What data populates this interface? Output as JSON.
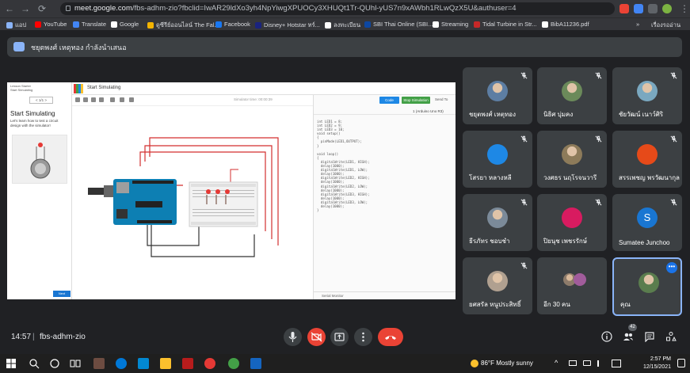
{
  "browser": {
    "url_host": "meet.google.com",
    "url_path": "/fbs-adhm-zio?fbclid=IwAR29ldXo3yh4NpYiwgXPUOCy3XHUQt1Tr-QUhl-yUS7n9xAWbh1RLwQzX5U&authuser=4",
    "bookmarks": [
      {
        "label": "แอป",
        "color": "#8ab4f8"
      },
      {
        "label": "YouTube",
        "color": "#ff0000"
      },
      {
        "label": "Translate",
        "color": "#4285f4"
      },
      {
        "label": "Google",
        "color": "#ffffff"
      },
      {
        "label": "ดูซีรีย์ออนไลน์ The Fal...",
        "color": "#f4b400"
      },
      {
        "label": "Facebook",
        "color": "#1877f2"
      },
      {
        "label": "Disney+ Hotstar ทร์...",
        "color": "#1a237e"
      },
      {
        "label": "ลงทะเบียน",
        "color": "#ffffff"
      },
      {
        "label": "SBI Thai Online (SBI...",
        "color": "#0d47a1"
      },
      {
        "label": "Streaming",
        "color": "#ffffff"
      },
      {
        "label": "Tidal Turbine in Str...",
        "color": "#c62828"
      },
      {
        "label": "BibA11236.pdf",
        "color": "#ffffff"
      }
    ],
    "reading_list": "เรื่องรออ่าน",
    "more": "»"
  },
  "presenter": {
    "text": "ชยุตพงศ์ เหตุทอง กำลังนำเสนอ"
  },
  "tinkercad": {
    "left_header": "Lesson Starter",
    "left_header2": "Start Simulating",
    "step_label": "< 1/1 >",
    "lesson_title": "Start Simulating",
    "lesson_text": "Let's learn how to test a circuit design with the simulator!",
    "next_label": "Next",
    "title": "Start Simulating",
    "timer": "Simulator time: 00:00:39",
    "code_btn": "Code",
    "sim_btn": "Stop Simulation",
    "share_btn": "Send To",
    "board_sel": "1 (Arduino Uno R3)",
    "serial_label": "Serial Monitor",
    "code": "int LED1 = 8;\nint LED2 = 9;\nint LED3 = 10;\nvoid setup()\n{\n  pinMode(LED1,OUTPUT);\n}\n\nvoid loop()\n{\n  digitalWrite(LED1, HIGH);\n  delay(1000);\n  digitalWrite(LED1, LOW);\n  delay(1000);\n  digitalWrite(LED2, HIGH);\n  delay(1000);\n  digitalWrite(LED2, LOW);\n  delay(1000);\n  digitalWrite(LED3, HIGH);\n  delay(1000);\n  digitalWrite(LED3, LOW);\n  delay(1000);\n}"
  },
  "tiles": [
    {
      "name": "ชยุตพงศ์ เหตุทอง",
      "avatar_color": "#5d7ea3",
      "initial": "",
      "muted": true,
      "photo": true
    },
    {
      "name": "นิธิศ บุ่มคง",
      "avatar_color": "#6b8a5a",
      "initial": "",
      "muted": true,
      "photo": true
    },
    {
      "name": "ชัยวัฒน์ เนาว์ศิริ",
      "avatar_color": "#7aa8c0",
      "initial": "",
      "muted": true,
      "photo": true
    },
    {
      "name": "โสรยา หลางหลี",
      "avatar_color": "#1e88e5",
      "initial": "",
      "muted": true,
      "photo": false
    },
    {
      "name": "วงศธร นฤโรจนวารี",
      "avatar_color": "#8d7b5a",
      "initial": "",
      "muted": true,
      "photo": true
    },
    {
      "name": "สรรเพชญ พรวัฒนากุล",
      "avatar_color": "#e64a19",
      "initial": "",
      "muted": true,
      "photo": false
    },
    {
      "name": "ธีรภัทร ชอบชำ",
      "avatar_color": "#7b8a99",
      "initial": "",
      "muted": true,
      "photo": true
    },
    {
      "name": "ปิยนุช เพชรรักษ์",
      "avatar_color": "#d81b60",
      "initial": "",
      "muted": true,
      "photo": false
    },
    {
      "name": "Sumatee Junchoo",
      "avatar_color": "#1976d2",
      "initial": "S",
      "muted": true,
      "photo": false
    },
    {
      "name": "ยศสรัล หนูประสิทธิ์",
      "avatar_color": "#b0a090",
      "initial": "",
      "muted": true,
      "photo": true
    },
    {
      "name": "อีก 30 คน",
      "avatar_color": "#a15c9b",
      "initial": "",
      "muted": false,
      "photo": false
    },
    {
      "name": "คุณ",
      "avatar_color": "#5a7d4e",
      "initial": "",
      "muted": true,
      "photo": true
    }
  ],
  "meet": {
    "time": "14:57",
    "separator": "|",
    "code": "fbs-adhm-zio",
    "people_count": "42",
    "colors": {
      "end_call": "#ea4335",
      "mic_off": "#ea4335",
      "self_border": "#8ab4f8"
    }
  },
  "taskbar": {
    "weather": "86°F  Mostly sunny",
    "time": "2:57 PM",
    "date": "12/15/2021"
  }
}
